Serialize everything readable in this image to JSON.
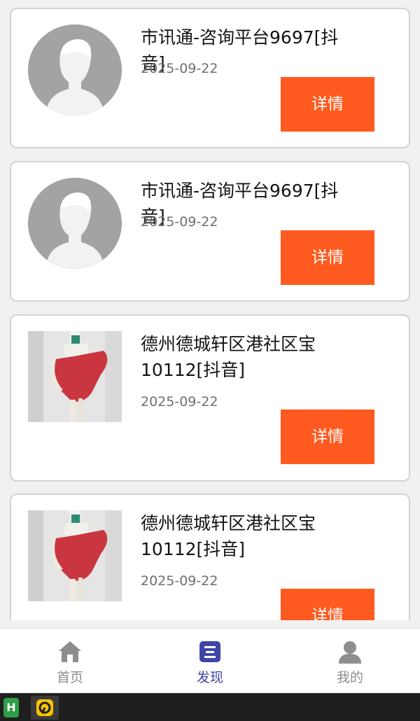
{
  "list": {
    "items": [
      {
        "title": "市讯通-咨询平台9697[抖音]",
        "date": "2025-09-22",
        "button_label": "详情",
        "thumbnail": "default-avatar"
      },
      {
        "title": "市讯通-咨询平台9697[抖音]",
        "date": "2025-09-22",
        "button_label": "详情",
        "thumbnail": "default-avatar"
      },
      {
        "title": "德州德城轩区港社区宝10112[抖音]",
        "date": "2025-09-22",
        "button_label": "详情",
        "thumbnail": "photo"
      },
      {
        "title": "德州德城轩区港社区宝10112[抖音]",
        "date": "2025-09-22",
        "button_label": "详情",
        "thumbnail": "photo"
      }
    ]
  },
  "tabbar": {
    "tabs": [
      {
        "label": "首页",
        "icon": "home-icon",
        "active": false
      },
      {
        "label": "发现",
        "icon": "discover-icon",
        "active": true
      },
      {
        "label": "我的",
        "icon": "user-icon",
        "active": false
      }
    ]
  },
  "taskbar": {
    "apps": [
      {
        "icon": "hbuilder-icon",
        "text": "H"
      },
      {
        "icon": "app-icon"
      }
    ]
  },
  "colors": {
    "accent_button": "#ff5a1f",
    "active_tab": "#3f46a8",
    "inactive_tab": "#8e8e8e"
  }
}
